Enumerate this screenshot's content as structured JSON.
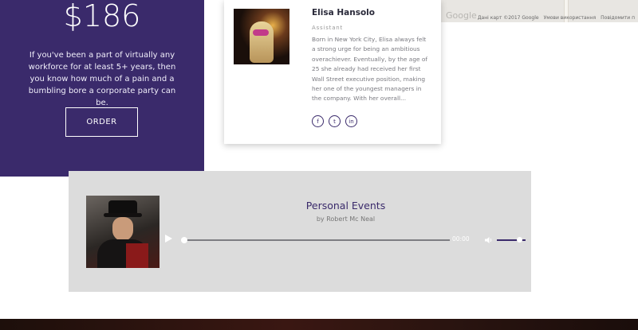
{
  "pricing": {
    "price": "$186",
    "description": "If you've been a part of virtually any workforce for at least 5+ years, then you know how much of a pain and a bumbling bore a corporate party can be.",
    "button_label": "ORDER",
    "background_color": "#3a2a6b"
  },
  "map": {
    "brand": "Google",
    "footer": [
      "Дані карт ©2017 Google",
      "Умови використання",
      "Повідомити п"
    ]
  },
  "team_member": {
    "name": "Elisa Hansolo",
    "role": "Assistant",
    "bio": "Born in New York City, Elisa always felt a strong urge for being an ambitious overachiever. Eventually, by the age of 25 she already had received her first Wall Street executive position, making her one of the youngest managers in the company. With her overall...",
    "socials": [
      {
        "icon": "facebook-icon",
        "glyph": "f"
      },
      {
        "icon": "twitter-icon",
        "glyph": "t"
      },
      {
        "icon": "linkedin-icon",
        "glyph": "in"
      }
    ]
  },
  "audio": {
    "title": "Personal Events",
    "artist": "by Robert Mc Neal",
    "time": "00:00",
    "progress": 0,
    "volume": 0.8,
    "accent_color": "#3a2a6b"
  }
}
